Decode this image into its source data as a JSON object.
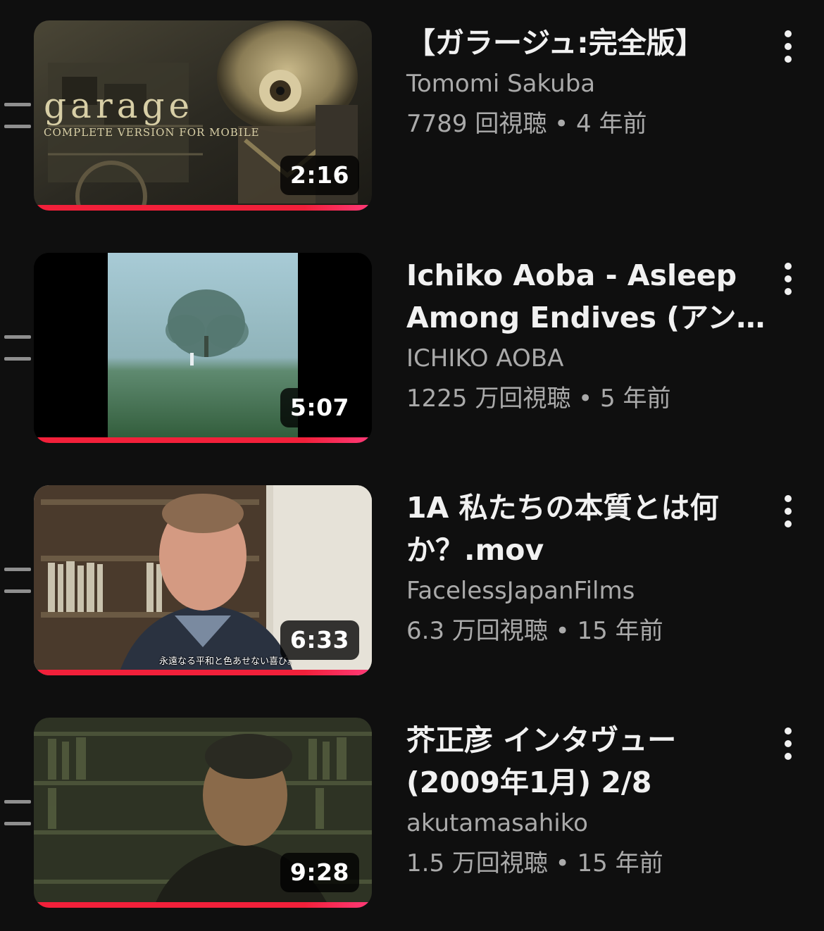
{
  "videos": [
    {
      "title": "【ガラージュ:完全版】",
      "channel": "Tomomi Sakuba",
      "meta": "7789 回視聴 • 4 年前",
      "duration": "2:16",
      "thumb_logo_main": "garage",
      "thumb_logo_sub": "COMPLETE VERSION FOR MOBILE",
      "watched_progress": 1.0
    },
    {
      "title": "Ichiko Aoba - Asleep Among Endives (アンディーヴと眠って)",
      "channel": "ICHIKO AOBA",
      "meta": "1225 万回視聴 • 5 年前",
      "duration": "5:07",
      "watched_progress": 1.0
    },
    {
      "title": "1A 私たちの本質とは何か？.mov",
      "channel": "FacelessJapanFilms",
      "meta": "6.3 万回視聴 • 15 年前",
      "duration": "6:33",
      "thumb_caption": "永遠なる平和と色あせない喜び。",
      "watched_progress": 1.0
    },
    {
      "title": "芥正彦 インタヴュー (2009年1月) 2/8",
      "channel": "akutamasahiko",
      "meta": "1.5 万回視聴 • 15 年前",
      "duration": "9:28",
      "watched_progress": 1.0
    }
  ],
  "icons": {
    "drag": "drag-handle-icon",
    "more": "more-vert-icon"
  },
  "colors": {
    "background": "#0f0f0f",
    "progress": "#f2203a",
    "secondary_text": "#aaaaaa"
  }
}
